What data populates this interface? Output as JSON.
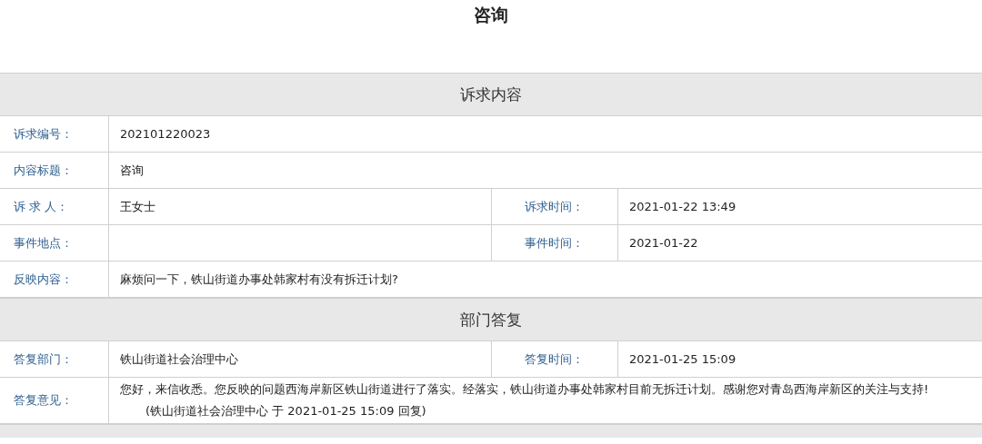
{
  "title": "咨询",
  "sections": [
    {
      "heading": "诉求内容",
      "rows": [
        {
          "cells": [
            {
              "label": "诉求编号：",
              "value": "202101220023"
            }
          ]
        },
        {
          "cells": [
            {
              "label": "内容标题：",
              "value": "咨询"
            }
          ]
        },
        {
          "cells": [
            {
              "label": "诉 求 人：",
              "value": "王女士"
            },
            {
              "label": "诉求时间：",
              "value": "2021-01-22 13:49"
            }
          ]
        },
        {
          "cells": [
            {
              "label": "事件地点："
            },
            {
              "label": "事件时间：",
              "value": "2021-01-22"
            }
          ]
        },
        {
          "cells": [
            {
              "label": "反映内容：",
              "value": "麻烦问一下，铁山街道办事处韩家村有没有拆迁计划?"
            }
          ]
        }
      ]
    },
    {
      "heading": "部门答复",
      "rows": [
        {
          "cells": [
            {
              "label": "答复部门：",
              "value": "铁山街道社会治理中心"
            },
            {
              "label": "答复时间：",
              "value": "2021-01-25 15:09"
            }
          ]
        },
        {
          "cells": [
            {
              "label": "答复意见：",
              "value": "您好，来信收悉。您反映的问题西海岸新区铁山街道进行了落实。经落实，铁山街道办事处韩家村目前无拆迁计划。感谢您对青岛西海岸新区的关注与支持!",
              "note": "(铁山街道社会治理中心 于 2021-01-25 15:09 回复)"
            }
          ]
        }
      ]
    }
  ]
}
